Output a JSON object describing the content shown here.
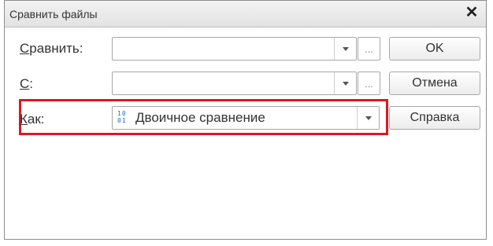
{
  "window": {
    "title": "Сравнить файлы"
  },
  "fields": {
    "compare": {
      "label_underlined": "С",
      "label_rest": "равнить:",
      "value": ""
    },
    "with": {
      "label_underlined": "С",
      "label_rest": ":",
      "value": ""
    },
    "how": {
      "label_underlined": "К",
      "label_rest": "ак:",
      "value": "Двоичное сравнение",
      "icon": "binary-icon",
      "icon_glyph": "10\n01"
    }
  },
  "ellipsis": "...",
  "buttons": {
    "ok": "OK",
    "cancel": "Отмена",
    "help": "Справка"
  },
  "colors": {
    "highlight": "#e0171e",
    "icon": "#1c6fbf"
  }
}
